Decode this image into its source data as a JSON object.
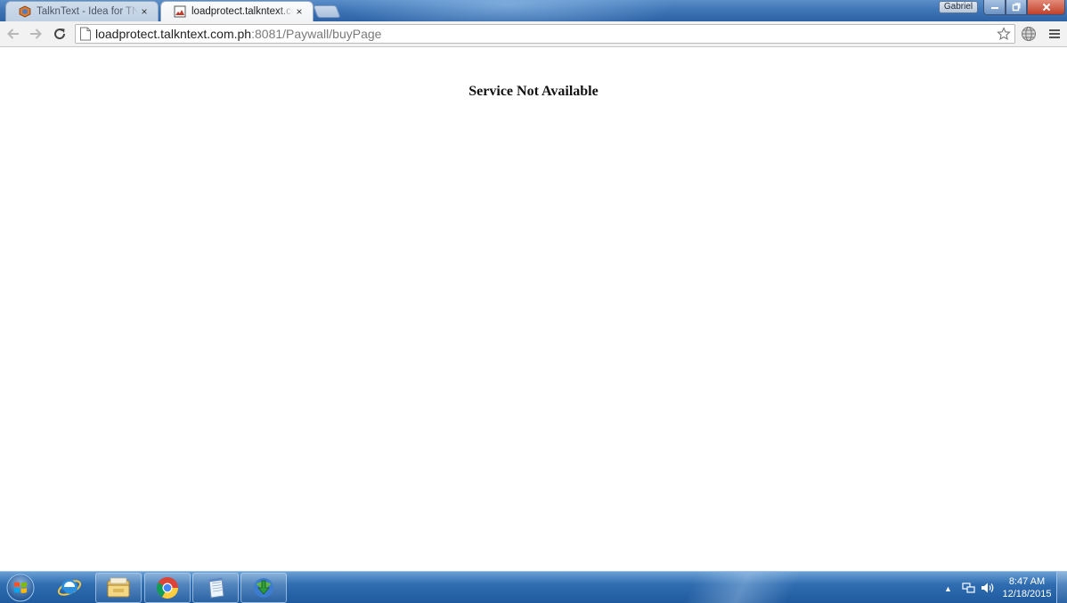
{
  "browser": {
    "tabs": [
      {
        "title": "TalknText - Idea for TNT n",
        "favicon": "talkntext-favicon",
        "active": false
      },
      {
        "title": "loadprotect.talkntext.com.",
        "favicon": "broken-page-favicon",
        "active": true
      }
    ],
    "close_icon": "×",
    "user": "Gabriel",
    "address": {
      "host": "loadprotect.talkntext.com.ph",
      "path": ":8081/Paywall/buyPage"
    }
  },
  "page": {
    "heading": "Service Not Available"
  },
  "taskbar": {
    "pinned": [
      "start-orb",
      "internet-explorer",
      "windows-explorer",
      "google-chrome",
      "notepad",
      "internet-download-manager"
    ],
    "clock": {
      "time": "8:47 AM",
      "date": "12/18/2015"
    }
  },
  "colors": {
    "titlebar": "#3f76b6",
    "taskbar": "#2f6cb0",
    "toolbar": "#f2f2f2"
  }
}
